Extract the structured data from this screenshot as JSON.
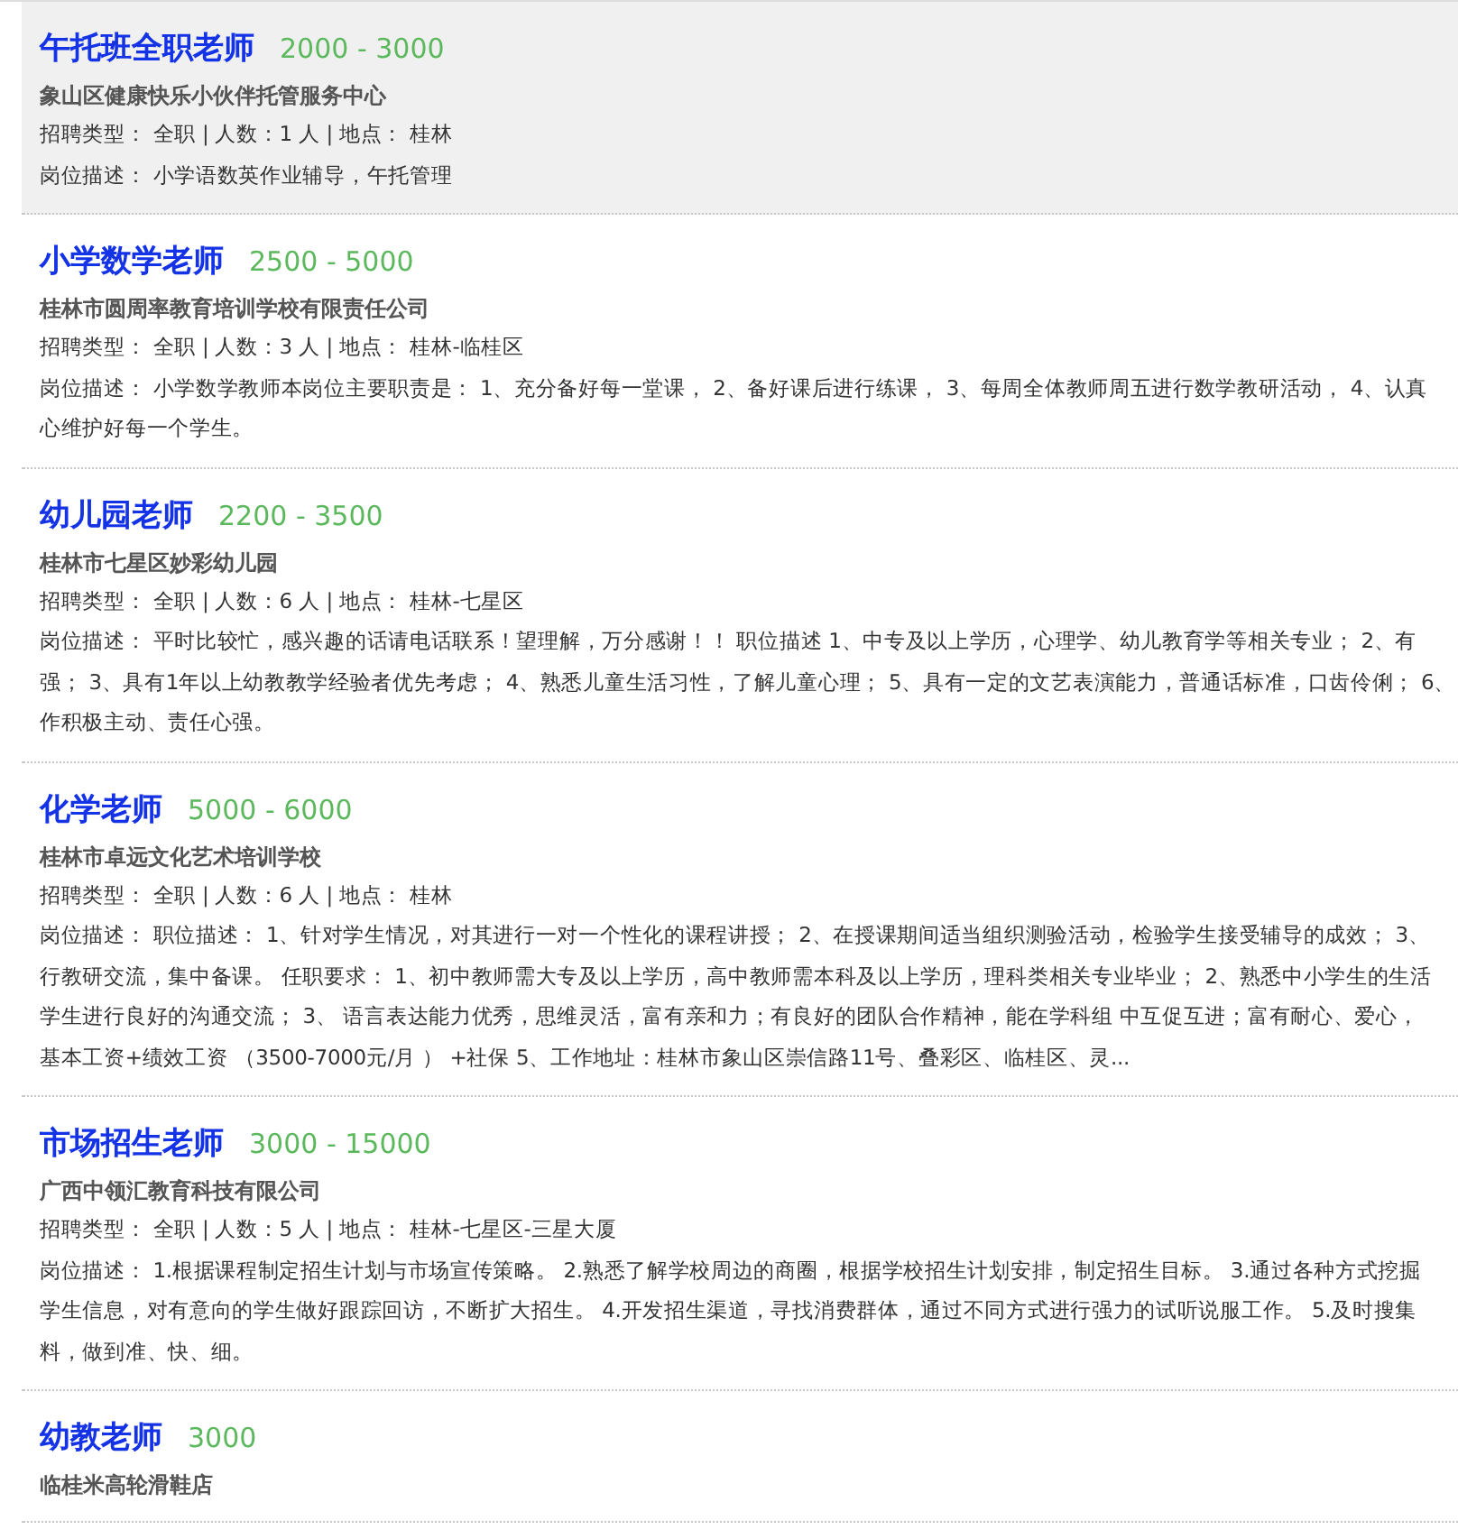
{
  "jobs": [
    {
      "title": "午托班全职老师",
      "salary": "2000 - 3000",
      "company": "象山区健康快乐小伙伴托管服务中心",
      "meta": "招聘类型： 全职 | 人数：1 人 | 地点： 桂林",
      "description": [
        "岗位描述： 小学语数英作业辅导，午托管理"
      ],
      "highlighted": true
    },
    {
      "title": "小学数学老师",
      "salary": "2500 - 5000",
      "company": "桂林市圆周率教育培训学校有限责任公司",
      "meta": "招聘类型： 全职 | 人数：3 人 | 地点： 桂林-临桂区",
      "description": [
        "岗位描述： 小学数学教师本岗位主要职责是： 1、充分备好每一堂课， 2、备好课后进行练课， 3、每周全体教师周五进行数学教研活动， 4、认真",
        "心维护好每一个学生。"
      ],
      "highlighted": false
    },
    {
      "title": "幼儿园老师",
      "salary": "2200 - 3500",
      "company": "桂林市七星区妙彩幼儿园",
      "meta": "招聘类型： 全职 | 人数：6 人 | 地点： 桂林-七星区",
      "description": [
        "岗位描述： 平时比较忙，感兴趣的话请电话联系！望理解，万分感谢！！ 职位描述 1、中专及以上学历，心理学、幼儿教育学等相关专业； 2、有",
        "强； 3、具有1年以上幼教教学经验者优先考虑； 4、熟悉儿童生活习性，了解儿童心理； 5、具有一定的文艺表演能力，普通话标准，口齿伶俐； 6、",
        "作积极主动、责任心强。"
      ],
      "highlighted": false
    },
    {
      "title": "化学老师",
      "salary": "5000 - 6000",
      "company": "桂林市卓远文化艺术培训学校",
      "meta": "招聘类型： 全职 | 人数：6 人 | 地点： 桂林",
      "description": [
        "岗位描述： 职位描述： 1、针对学生情况，对其进行一对一个性化的课程讲授； 2、在授课期间适当组织测验活动，检验学生接受辅导的成效； 3、",
        "行教研交流，集中备课。 任职要求： 1、初中教师需大专及以上学历，高中教师需本科及以上学历，理科类相关专业毕业； 2、熟悉中小学生的生活",
        "学生进行良好的沟通交流； 3、 语言表达能力优秀，思维灵活，富有亲和力；有良好的团队合作精神，能在学科组 中互促互进；富有耐心、爱心，",
        "基本工资+绩效工资 （3500-7000元/月 ） +社保 5、工作地址：桂林市象山区崇信路11号、叠彩区、临桂区、灵..."
      ],
      "highlighted": false
    },
    {
      "title": "市场招生老师",
      "salary": "3000 - 15000",
      "company": "广西中领汇教育科技有限公司",
      "meta": "招聘类型： 全职 | 人数：5 人 | 地点： 桂林-七星区-三星大厦",
      "description": [
        "岗位描述： 1.根据课程制定招生计划与市场宣传策略。 2.熟悉了解学校周边的商圈，根据学校招生计划安排，制定招生目标。 3.通过各种方式挖掘",
        "学生信息，对有意向的学生做好跟踪回访，不断扩大招生。 4.开发招生渠道，寻找消费群体，通过不同方式进行强力的试听说服工作。 5.及时搜集",
        "料，做到准、快、细。"
      ],
      "highlighted": false
    },
    {
      "title": "幼教老师",
      "salary": "3000",
      "company": "临桂米高轮滑鞋店",
      "highlighted": false
    }
  ]
}
